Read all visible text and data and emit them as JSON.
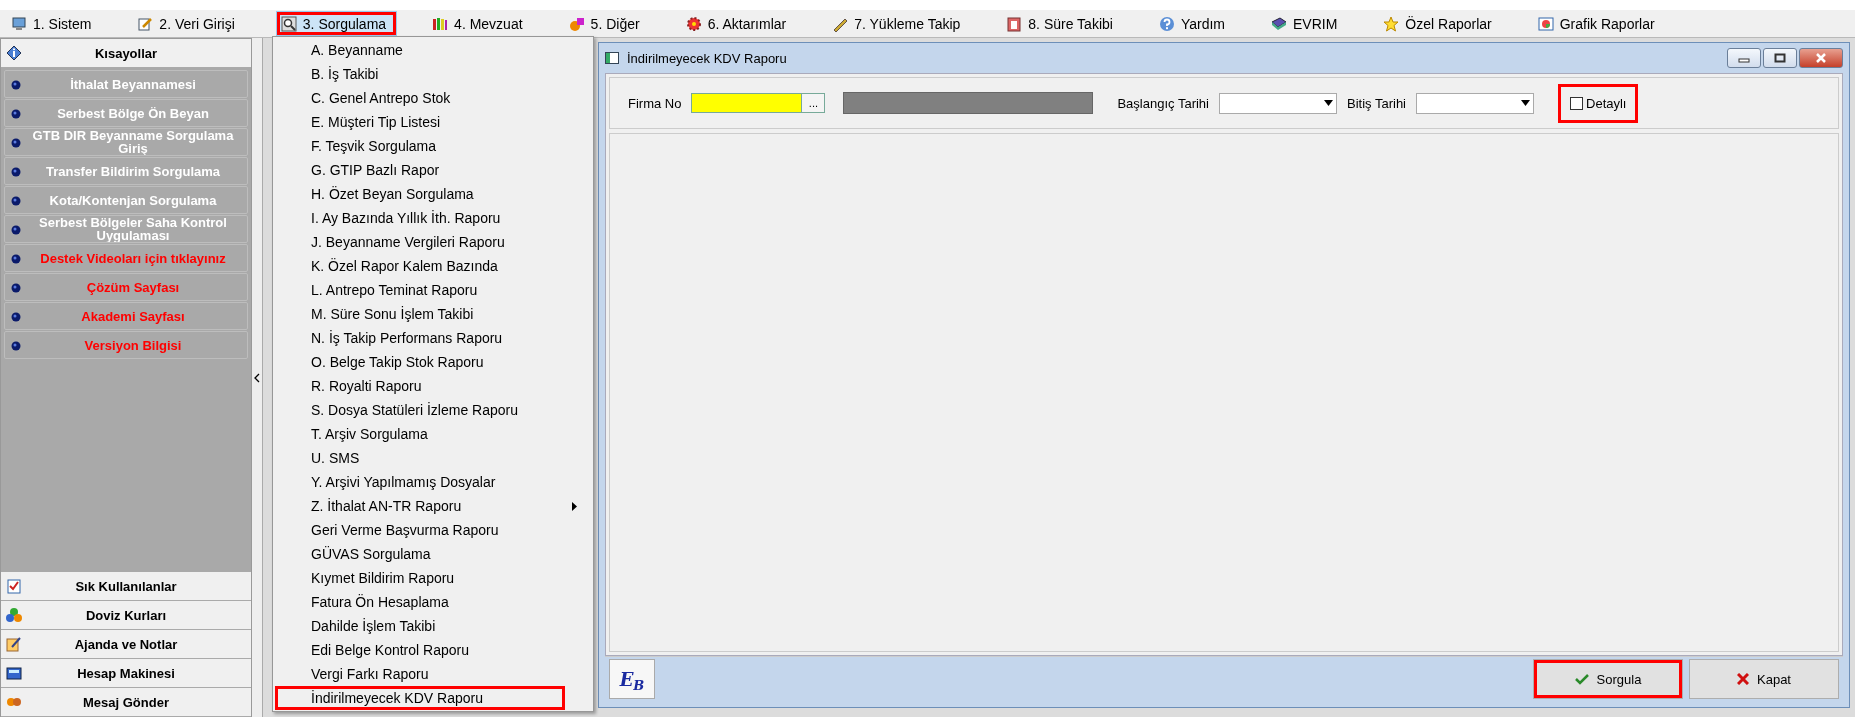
{
  "menu_bar": {
    "items": [
      {
        "label": "1. Sistem",
        "selected": false,
        "annotated": false
      },
      {
        "label": "2. Veri Girişi",
        "selected": false,
        "annotated": false
      },
      {
        "label": "3. Sorgulama",
        "selected": true,
        "annotated": true
      },
      {
        "label": "4. Mevzuat",
        "selected": false,
        "annotated": false
      },
      {
        "label": "5. Diğer",
        "selected": false,
        "annotated": false
      },
      {
        "label": "6. Aktarımlar",
        "selected": false,
        "annotated": false
      },
      {
        "label": "7. Yükleme Takip",
        "selected": false,
        "annotated": false
      },
      {
        "label": "8. Süre Takibi",
        "selected": false,
        "annotated": false
      },
      {
        "label": "Yardım",
        "selected": false,
        "annotated": false
      },
      {
        "label": "EVRIM",
        "selected": false,
        "annotated": false
      },
      {
        "label": "Özel Raporlar",
        "selected": false,
        "annotated": false
      },
      {
        "label": "Grafik Raporlar",
        "selected": false,
        "annotated": false
      }
    ]
  },
  "sidebar": {
    "header": "Kısayollar",
    "items": [
      {
        "label": "İthalat Beyannamesi",
        "color": "#ffffff"
      },
      {
        "label": "Serbest Bölge Ön Beyan",
        "color": "#ffffff"
      },
      {
        "label": "GTB DIR Beyanname Sorgulama Giriş",
        "color": "#ffffff"
      },
      {
        "label": "Transfer Bildirim Sorgulama",
        "color": "#ffffff"
      },
      {
        "label": "Kota/Kontenjan Sorgulama",
        "color": "#ffffff"
      },
      {
        "label": "Serbest Bölgeler Saha Kontrol Uygulaması",
        "color": "#ffffff"
      },
      {
        "label": "Destek Videoları için tıklayınız",
        "color": "#ff0000"
      },
      {
        "label": "Çözüm Sayfası",
        "color": "#ff0000"
      },
      {
        "label": "Akademi Sayfası",
        "color": "#ff0000"
      },
      {
        "label": "Versiyon Bilgisi",
        "color": "#ff0000"
      }
    ],
    "bottom_items": [
      "Sık Kullanılanlar",
      "Doviz Kurları",
      "Ajanda ve Notlar",
      "Hesap Makinesi",
      "Mesaj Gönder"
    ]
  },
  "dropdown": {
    "items": [
      {
        "label": "A. Beyanname",
        "submenu": false,
        "annotated": false
      },
      {
        "label": "B. İş Takibi",
        "submenu": false,
        "annotated": false
      },
      {
        "label": "C. Genel Antrepo Stok",
        "submenu": false,
        "annotated": false
      },
      {
        "label": "E. Müşteri Tip Listesi",
        "submenu": false,
        "annotated": false
      },
      {
        "label": "F. Teşvik Sorgulama",
        "submenu": false,
        "annotated": false
      },
      {
        "label": "G. GTIP Bazlı Rapor",
        "submenu": false,
        "annotated": false
      },
      {
        "label": "H. Özet Beyan Sorgulama",
        "submenu": false,
        "annotated": false
      },
      {
        "label": "I. Ay Bazında Yıllık İth. Raporu",
        "submenu": false,
        "annotated": false
      },
      {
        "label": "J. Beyanname Vergileri Raporu",
        "submenu": false,
        "annotated": false
      },
      {
        "label": "K. Özel Rapor Kalem Bazında",
        "submenu": false,
        "annotated": false
      },
      {
        "label": "L. Antrepo Teminat Raporu",
        "submenu": false,
        "annotated": false
      },
      {
        "label": "M. Süre Sonu İşlem Takibi",
        "submenu": false,
        "annotated": false
      },
      {
        "label": "N. İş Takip Performans Raporu",
        "submenu": false,
        "annotated": false
      },
      {
        "label": "O. Belge Takip Stok Raporu",
        "submenu": false,
        "annotated": false
      },
      {
        "label": "R. Royalti Raporu",
        "submenu": false,
        "annotated": false
      },
      {
        "label": "S. Dosya Statüleri İzleme Raporu",
        "submenu": false,
        "annotated": false
      },
      {
        "label": "T. Arşiv Sorgulama",
        "submenu": false,
        "annotated": false
      },
      {
        "label": "U. SMS",
        "submenu": false,
        "annotated": false
      },
      {
        "label": "Y. Arşivi Yapılmamış Dosyalar",
        "submenu": false,
        "annotated": false
      },
      {
        "label": "Z. İthalat AN-TR Raporu",
        "submenu": true,
        "annotated": false
      },
      {
        "label": "Geri Verme Başvurma Raporu",
        "submenu": false,
        "annotated": false
      },
      {
        "label": "GÜVAS Sorgulama",
        "submenu": false,
        "annotated": false
      },
      {
        "label": "Kıymet Bildirim Raporu",
        "submenu": false,
        "annotated": false
      },
      {
        "label": "Fatura Ön Hesaplama",
        "submenu": false,
        "annotated": false
      },
      {
        "label": "Dahilde İşlem Takibi",
        "submenu": false,
        "annotated": false
      },
      {
        "label": "Edi Belge Kontrol Raporu",
        "submenu": false,
        "annotated": false
      },
      {
        "label": "Vergi Farkı Raporu",
        "submenu": false,
        "annotated": false
      },
      {
        "label": "İndirilmeyecek KDV Raporu",
        "submenu": false,
        "annotated": true
      }
    ]
  },
  "dialog": {
    "title": "İndirilmeyecek KDV Raporu",
    "filters": {
      "firma_label": "Firma No",
      "firma_button": "...",
      "start_label": "Başlangıç Tarihi",
      "end_label": "Bitiş Tarihi",
      "detail": {
        "label": "Detaylı",
        "checked": false,
        "annotated": true
      }
    },
    "logo_letters": [
      "E",
      "B"
    ],
    "buttons": [
      {
        "label": "Sorgula",
        "kind": "confirm",
        "annotated": true
      },
      {
        "label": "Kapat",
        "kind": "close",
        "annotated": false
      }
    ]
  }
}
